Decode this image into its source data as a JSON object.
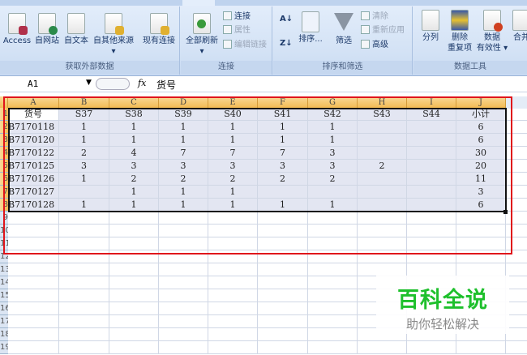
{
  "ribbon": {
    "groups": [
      {
        "label": "获取外部数据",
        "buttons": [
          "Access",
          "自网站",
          "自文本",
          "自其他来源",
          "现有连接"
        ]
      },
      {
        "label": "连接",
        "refresh": "全部刷新",
        "small": [
          "连接",
          "属性",
          "编辑链接"
        ]
      },
      {
        "label": "排序和筛选",
        "sort": "排序...",
        "filter": "筛选",
        "small": [
          "清除",
          "重新应用",
          "高级"
        ]
      },
      {
        "label": "数据工具",
        "buttons": [
          "分列",
          "删除\n重复项",
          "数据\n有效性 ▾",
          "合并"
        ]
      }
    ]
  },
  "formula_bar": {
    "name_box": "A1",
    "fx": "fx",
    "value": "货号"
  },
  "sheet": {
    "columns": [
      "A",
      "B",
      "C",
      "D",
      "E",
      "F",
      "G",
      "H",
      "I",
      "J"
    ],
    "rows": [
      [
        "货号",
        "S37",
        "S38",
        "S39",
        "S40",
        "S41",
        "S42",
        "S43",
        "S44",
        "小计"
      ],
      [
        "B7170118",
        "1",
        "1",
        "1",
        "1",
        "1",
        "1",
        "",
        "",
        "6"
      ],
      [
        "B7170120",
        "1",
        "1",
        "1",
        "1",
        "1",
        "1",
        "",
        "",
        "6"
      ],
      [
        "B7170122",
        "2",
        "4",
        "7",
        "7",
        "7",
        "3",
        "",
        "",
        "30"
      ],
      [
        "B7170125",
        "3",
        "3",
        "3",
        "3",
        "3",
        "3",
        "2",
        "",
        "20"
      ],
      [
        "B7170126",
        "1",
        "2",
        "2",
        "2",
        "2",
        "2",
        "",
        "",
        "11"
      ],
      [
        "B7170127",
        "",
        "1",
        "1",
        "1",
        "",
        "",
        "",
        "",
        "3"
      ],
      [
        "B7170128",
        "1",
        "1",
        "1",
        "1",
        "1",
        "1",
        "",
        "",
        "6"
      ]
    ],
    "row_numbers": [
      "1",
      "2",
      "3",
      "4",
      "5",
      "6",
      "7",
      "8",
      "9",
      "10",
      "11",
      "12",
      "13",
      "14",
      "15",
      "16",
      "17",
      "18",
      "19"
    ]
  },
  "watermark": {
    "title": "百科全说",
    "subtitle": "助你轻松解决"
  }
}
